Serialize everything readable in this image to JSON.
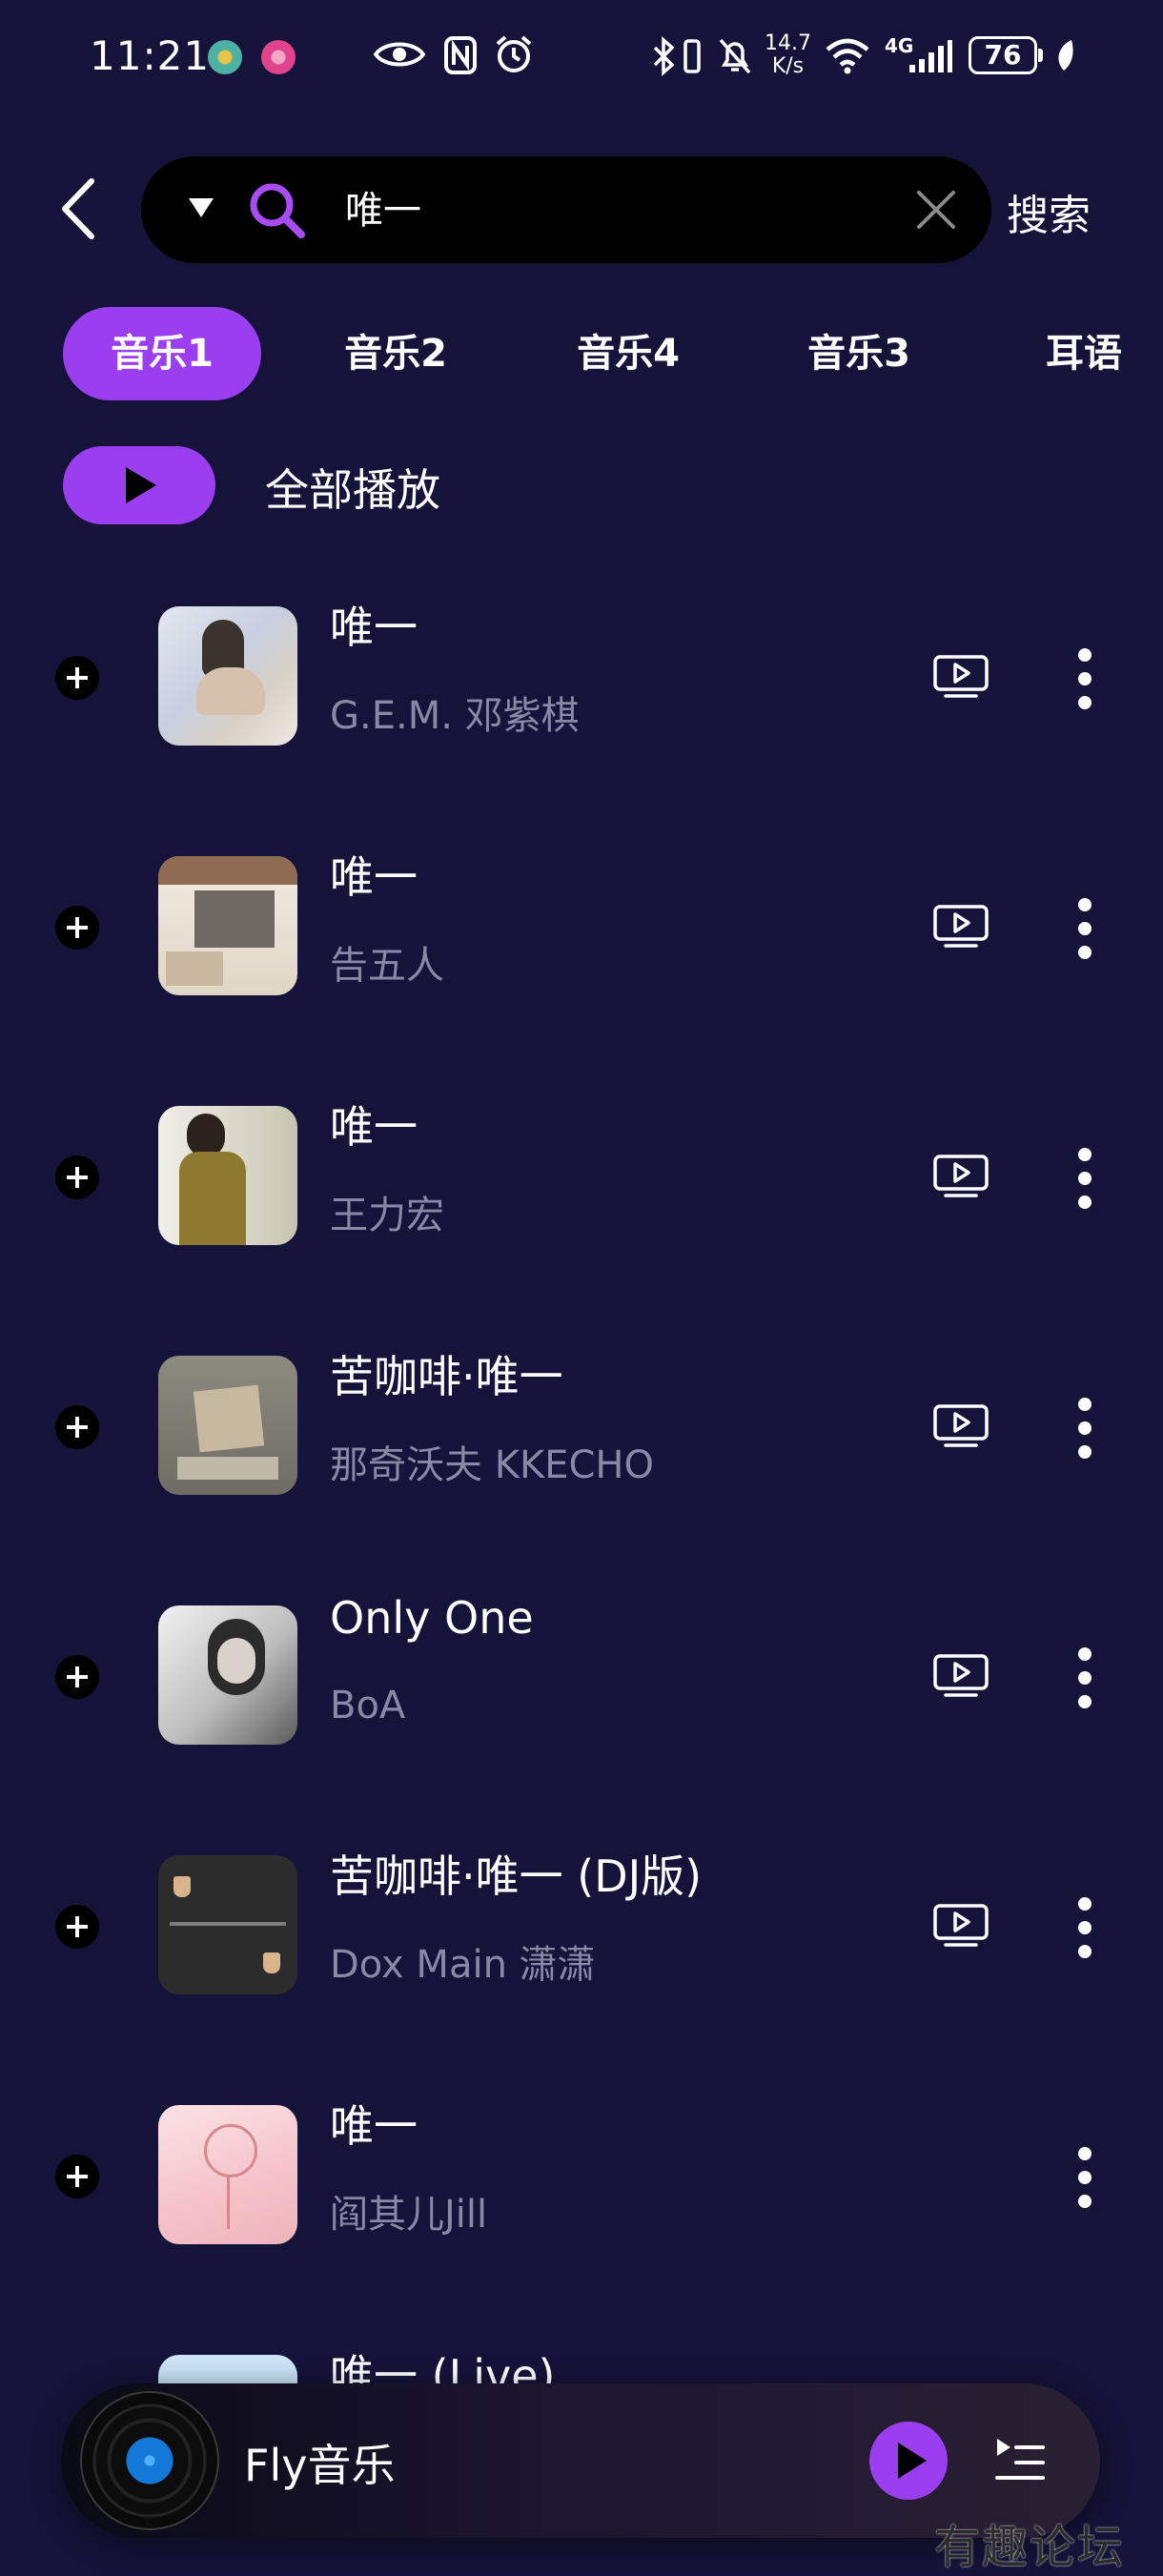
{
  "status_bar": {
    "time": "11:21",
    "network_speed_value": "14.7",
    "network_speed_unit": "K/s",
    "network_type": "4G",
    "battery_level": "76"
  },
  "search": {
    "query": "唯一",
    "submit_label": "搜索"
  },
  "tabs": [
    {
      "label": "音乐1",
      "active": true
    },
    {
      "label": "音乐2",
      "active": false
    },
    {
      "label": "音乐4",
      "active": false
    },
    {
      "label": "音乐3",
      "active": false
    },
    {
      "label": "耳语",
      "active": false
    }
  ],
  "play_all": {
    "label": "全部播放"
  },
  "songs": [
    {
      "title": "唯一",
      "artist": "G.E.M. 邓紫棋",
      "has_mv": true
    },
    {
      "title": "唯一",
      "artist": "告五人",
      "has_mv": true
    },
    {
      "title": "唯一",
      "artist": "王力宏",
      "has_mv": true
    },
    {
      "title": "苦咖啡·唯一",
      "artist": "那奇沃夫 KKECHO",
      "has_mv": true
    },
    {
      "title": "Only One",
      "artist": "BoA",
      "has_mv": true
    },
    {
      "title": "苦咖啡·唯一 (DJ版)",
      "artist": "Dox Main 潇潇",
      "has_mv": true
    },
    {
      "title": "唯一",
      "artist": "阎其儿Jill",
      "has_mv": false
    },
    {
      "title": "唯一 (Live)",
      "artist": "",
      "has_mv": false
    }
  ],
  "player": {
    "title": "Fly音乐"
  },
  "watermark": "有趣论坛",
  "colors": {
    "background": "#16133a",
    "accent": "#9b3ef0",
    "secondary_text": "#8b87a6"
  }
}
